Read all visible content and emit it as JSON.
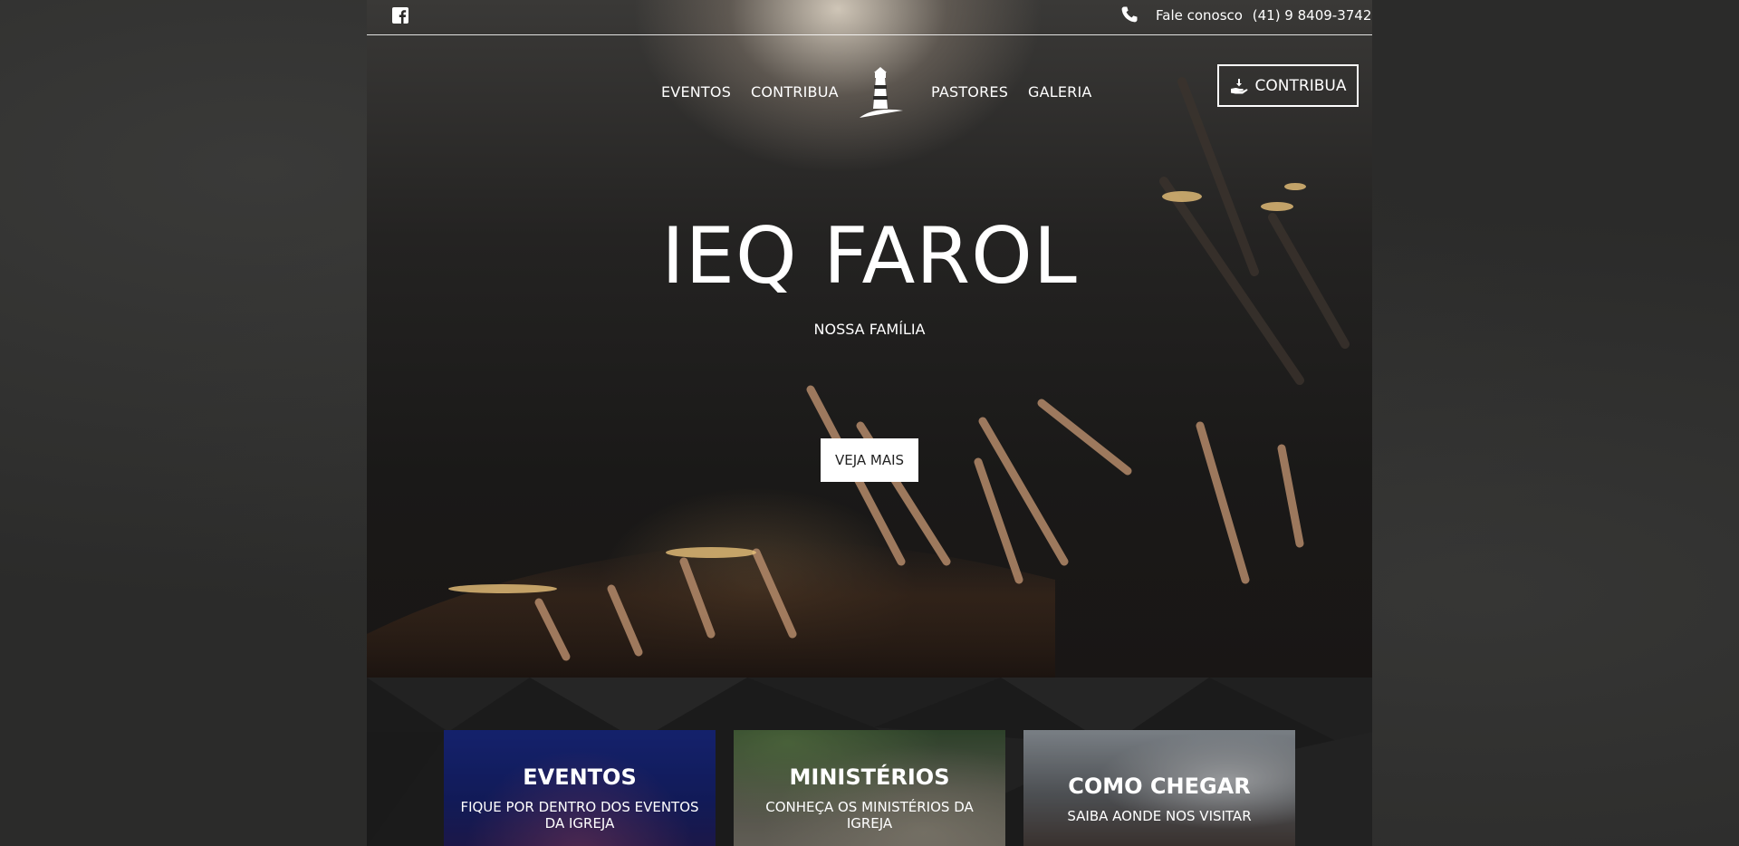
{
  "topbar": {
    "social_icon": "facebook-icon",
    "phone_icon": "phone-icon",
    "contact_label": "Fale conosco",
    "phone": "(41) 9 8409-3742"
  },
  "nav": {
    "items": [
      {
        "label": "EVENTOS"
      },
      {
        "label": "CONTRIBUA"
      },
      {
        "label": "PASTORES"
      },
      {
        "label": "GALERIA"
      }
    ],
    "logo_icon": "lighthouse-icon",
    "cta_icon": "hand-money-icon",
    "cta_label": "CONTRIBUA"
  },
  "hero": {
    "title": "IEQ FAROL",
    "subtitle": "NOSSA FAMÍLIA",
    "button_label": "VEJA MAIS"
  },
  "cards": [
    {
      "title": "EVENTOS",
      "subtitle": "FIQUE POR DENTRO DOS EVENTOS DA IGREJA"
    },
    {
      "title": "MINISTÉRIOS",
      "subtitle": "CONHEÇA OS MINISTÉRIOS DA IGREJA"
    },
    {
      "title": "COMO CHEGAR",
      "subtitle": "SAIBA AONDE NOS VISITAR"
    }
  ],
  "colors": {
    "page_background": "#2b2b2a",
    "hero_dark": "#1a1918",
    "cards_background": "#1b1b1b",
    "button_background": "#ffffff",
    "button_text": "#222222",
    "card_events_blue": "#1d2f96"
  }
}
